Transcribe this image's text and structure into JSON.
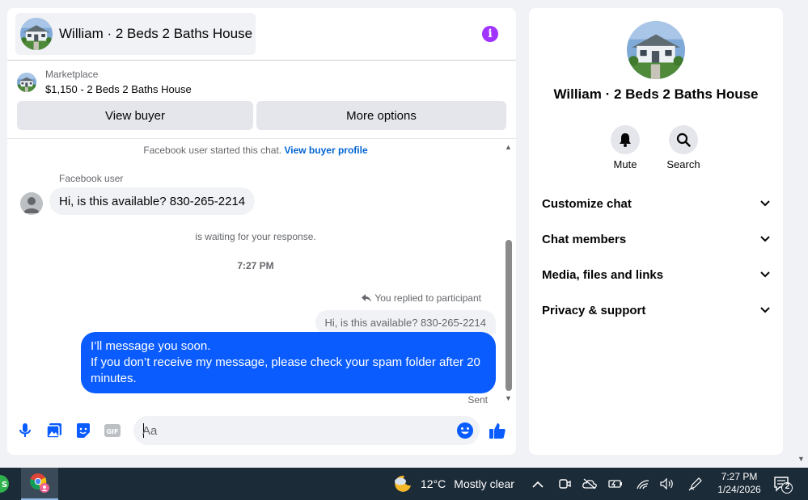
{
  "chat": {
    "title": "William · 2 Beds 2 Baths House",
    "marketplace_label": "Marketplace",
    "listing": "$1,150 - 2 Beds 2 Baths House",
    "view_buyer": "View buyer",
    "more_options": "More options",
    "started_text": "Facebook user started this chat.",
    "view_buyer_profile": "View buyer profile",
    "sender_name": "Facebook user",
    "incoming_message": "Hi, is this available? 830-265-2214",
    "waiting_text": "is waiting for your response.",
    "timestamp": "7:27 PM",
    "replied_label": "You replied to participant",
    "quoted_message": "Hi, is this available? 830-265-2214",
    "outgoing_line1": "I’ll message you soon.",
    "outgoing_line2": "If you don’t receive my message, please check your spam folder after 20 minutes.",
    "sent_label": "Sent",
    "input_placeholder": "Aa",
    "input_value": ""
  },
  "info_panel": {
    "title": "William · 2 Beds 2 Baths House",
    "mute_label": "Mute",
    "search_label": "Search",
    "menu": [
      {
        "label": "Customize chat"
      },
      {
        "label": "Chat members"
      },
      {
        "label": "Media, files and links"
      },
      {
        "label": "Privacy & support"
      }
    ]
  },
  "taskbar": {
    "temperature": "12°C",
    "condition": "Mostly clear",
    "time": "7:27 PM",
    "date": "1/24/2026",
    "notification_count": "2"
  },
  "colors": {
    "accent_blue": "#0a5cff",
    "link_blue": "#0064d1",
    "info_purple": "#a033ff",
    "taskbar_bg": "#1c2b38"
  }
}
